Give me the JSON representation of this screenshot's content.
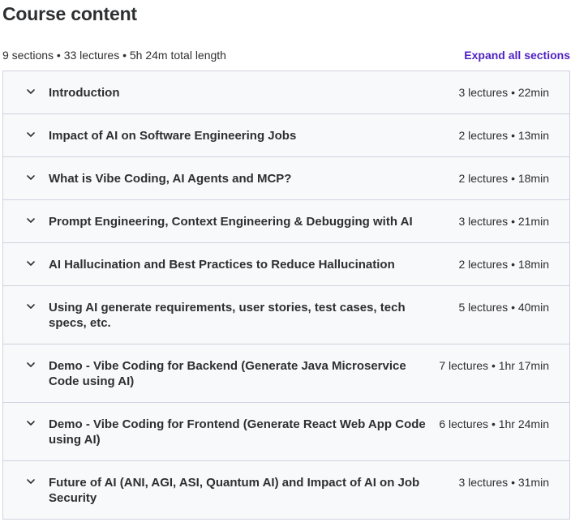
{
  "heading": "Course content",
  "summary": "9 sections • 33 lectures • 5h 24m total length",
  "expand_label": "Expand all sections",
  "sections": [
    {
      "title": "Introduction",
      "meta": "3 lectures • 22min",
      "icon": "chevron-down-icon"
    },
    {
      "title": "Impact of AI on Software Engineering Jobs",
      "meta": "2 lectures • 13min",
      "icon": "chevron-down-icon"
    },
    {
      "title": "What is Vibe Coding, AI Agents and MCP?",
      "meta": "2 lectures • 18min",
      "icon": "chevron-down-icon"
    },
    {
      "title": "Prompt Engineering, Context Engineering & Debugging with AI",
      "meta": "3 lectures • 21min",
      "icon": "chevron-down-icon"
    },
    {
      "title": "AI Hallucination and Best Practices to Reduce Hallucination",
      "meta": "2 lectures • 18min",
      "icon": "chevron-down-icon"
    },
    {
      "title": "Using AI generate requirements, user stories, test cases, tech specs, etc.",
      "meta": "5 lectures • 40min",
      "icon": "chevron-down-icon"
    },
    {
      "title": "Demo - Vibe Coding for Backend (Generate Java Microservice Code using AI)",
      "meta": "7 lectures • 1hr 17min",
      "icon": "chevron-down-icon"
    },
    {
      "title": "Demo - Vibe Coding for Frontend (Generate React Web App Code using AI)",
      "meta": "6 lectures • 1hr 24min",
      "icon": "chevron-down-icon"
    },
    {
      "title": "Future of AI (ANI, AGI, ASI, Quantum AI) and Impact of AI on Job Security",
      "meta": "3 lectures • 31min",
      "icon": "chevron-down-icon"
    }
  ],
  "colors": {
    "text": "#2d2f31",
    "link": "#5022c3",
    "row_bg": "#f7f9fa",
    "border": "#d1d2e0"
  }
}
